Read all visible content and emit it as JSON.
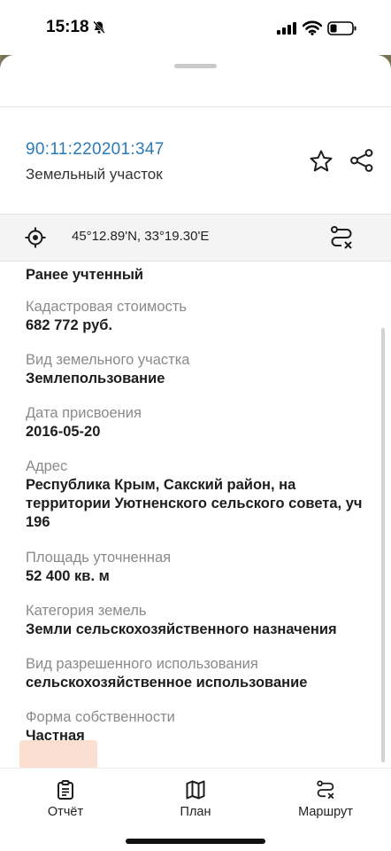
{
  "status_bar": {
    "time": "15:18",
    "icons": [
      "bell-slash-icon",
      "cellular-signal-icon",
      "wifi-icon",
      "battery-icon"
    ]
  },
  "header": {
    "cadastral_number": "90:11:220201:347",
    "object_type": "Земельный участок",
    "actions": [
      "star-icon",
      "share-icon"
    ]
  },
  "coordinates": {
    "text": "45°12.89'N, 33°19.30'E",
    "icons": [
      "location-target-icon",
      "route-clear-icon"
    ]
  },
  "details": [
    {
      "label": "",
      "value": "Ранее учтенный"
    },
    {
      "label": "Кадастровая стоимость",
      "value": "682 772 руб."
    },
    {
      "label": "Вид земельного участка",
      "value": "Землепользование"
    },
    {
      "label": "Дата присвоения",
      "value": "2016-05-20"
    },
    {
      "label": "Адрес",
      "value": "Республика Крым, Сакский район, на территории Уютненского сельского совета, уч 196"
    },
    {
      "label": "Площадь уточненная",
      "value": "52 400 кв. м"
    },
    {
      "label": "Категория земель",
      "value": "Земли сельскохозяйственного назначения"
    },
    {
      "label": "Вид разрешенного использования",
      "value": "сельскохозяйственное использование"
    },
    {
      "label": "Форма собственности",
      "value": "Частная"
    }
  ],
  "tabbar": {
    "report_label": "Отчёт",
    "plan_label": "План",
    "route_label": "Маршрут"
  },
  "colors": {
    "accent_link": "#2a7ab8",
    "label_gray": "#8a8a8a",
    "value_text": "#1d1d1d",
    "coords_bg": "#f4f4f5"
  }
}
